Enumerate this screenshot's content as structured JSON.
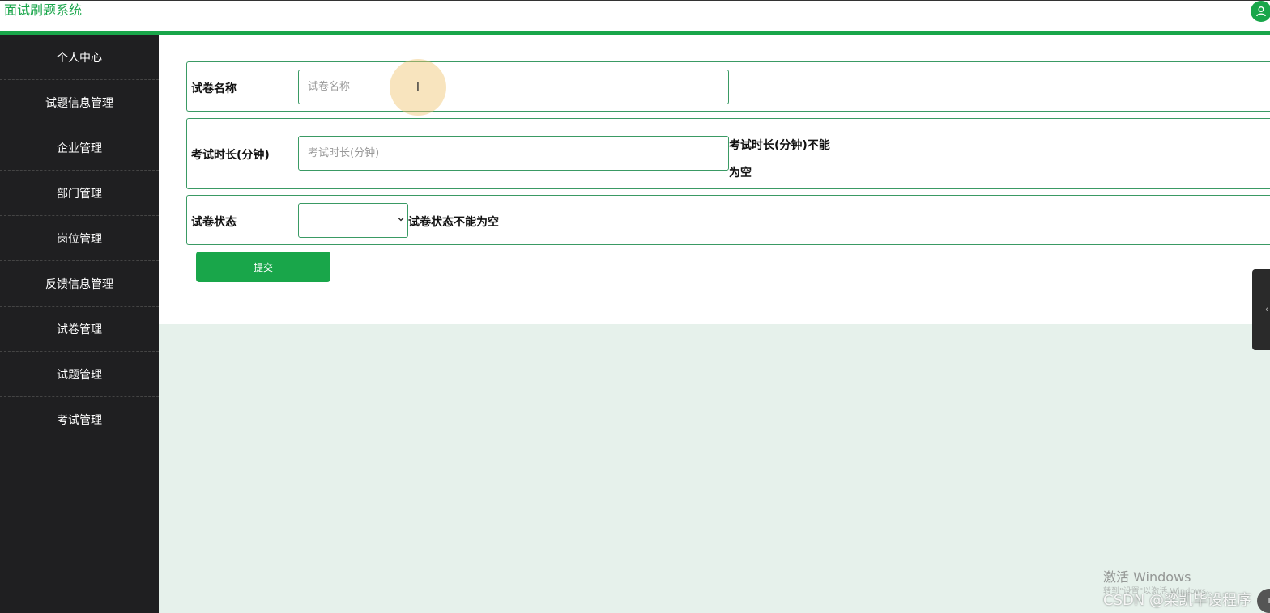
{
  "header": {
    "app_title": "面试刷题系统",
    "accent_color": "#19a64a",
    "user_icon": "user-icon"
  },
  "sidebar": {
    "items": [
      {
        "label": "个人中心"
      },
      {
        "label": "试题信息管理"
      },
      {
        "label": "企业管理"
      },
      {
        "label": "部门管理"
      },
      {
        "label": "岗位管理"
      },
      {
        "label": "反馈信息管理"
      },
      {
        "label": "试卷管理"
      },
      {
        "label": "试题管理"
      },
      {
        "label": "考试管理"
      }
    ]
  },
  "form": {
    "name": {
      "label": "试卷名称",
      "value": "",
      "placeholder": "试卷名称"
    },
    "duration": {
      "label": "考试时长(分钟)",
      "value": "",
      "placeholder": "考试时长(分钟)",
      "error_line1": "考试时长(分钟)不能",
      "error_line2": "为空"
    },
    "status": {
      "label": "试卷状态",
      "selected": "",
      "error": "试卷状态不能为空"
    },
    "submit_label": "提交"
  },
  "overlay": {
    "cursor_glyph": "I",
    "activation_title": "激活 Windows",
    "activation_sub": "转到\"设置\"以激活 Windows。",
    "csdn_watermark": "CSDN @梁凯毕设程序",
    "corner_badge": "T"
  }
}
